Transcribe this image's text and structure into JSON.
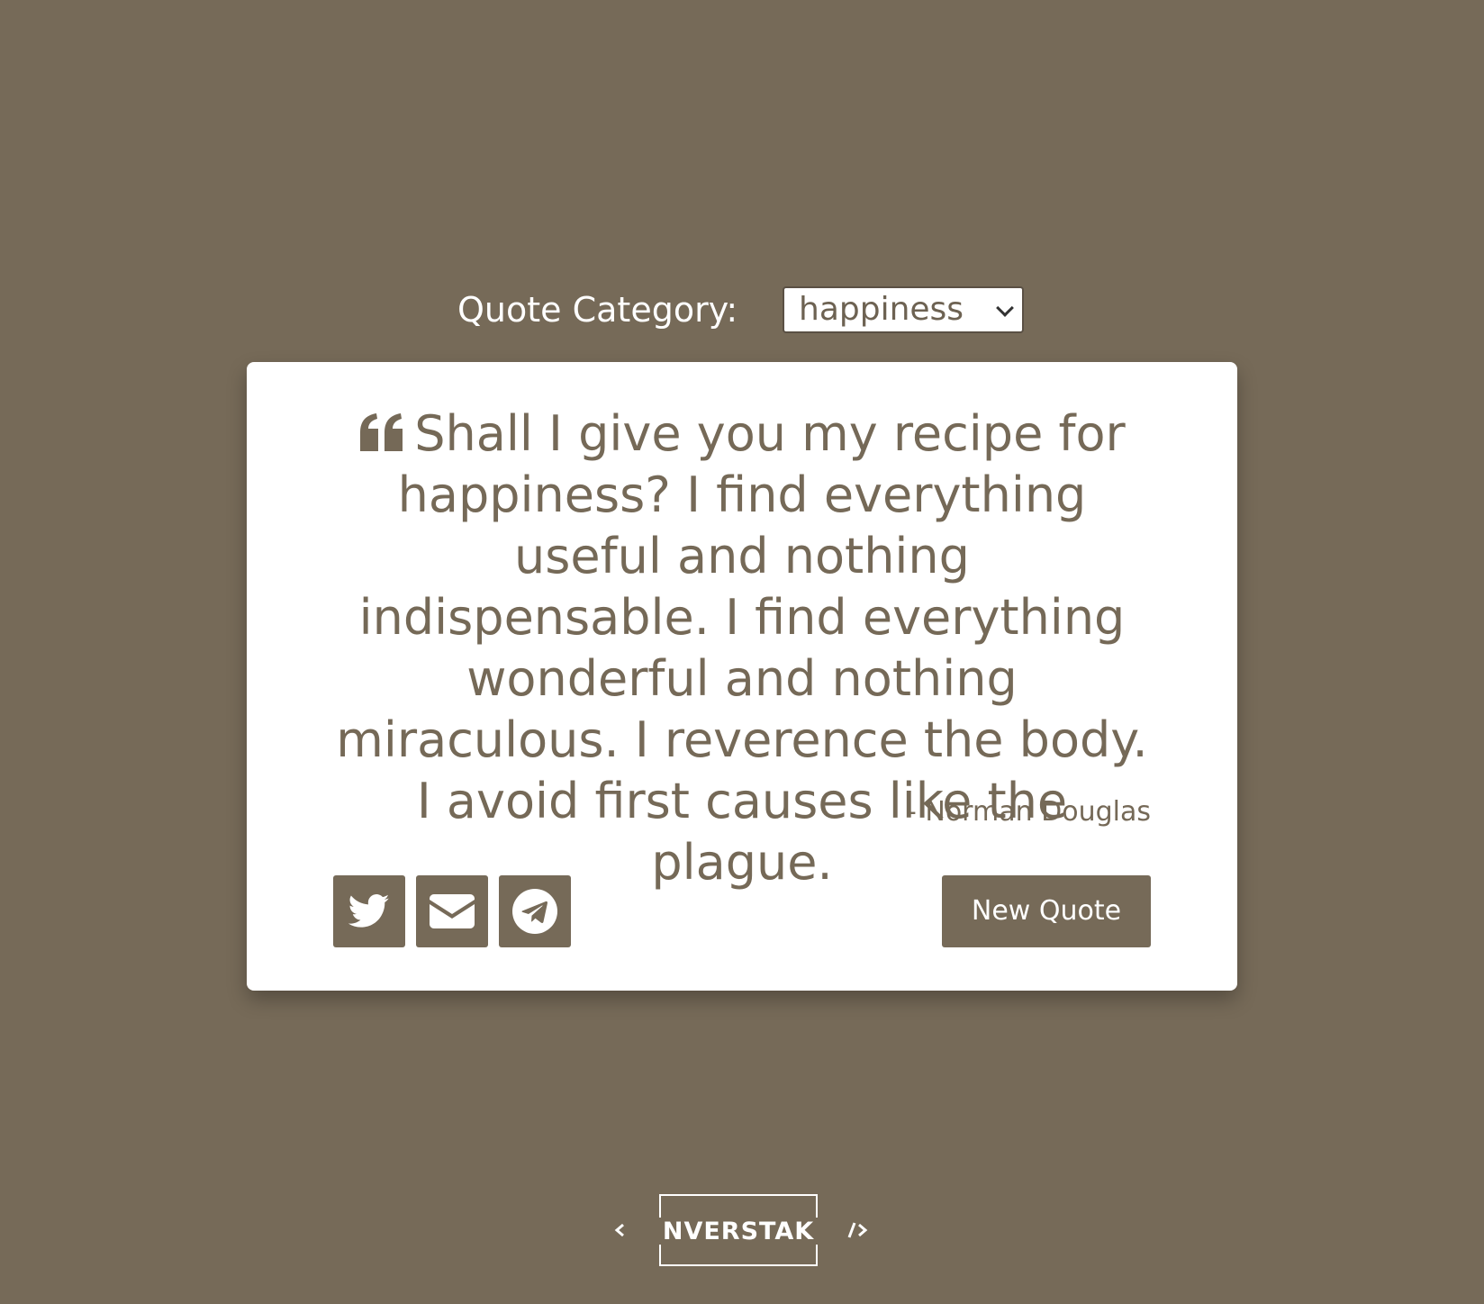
{
  "category": {
    "label": "Quote Category:",
    "selected": "happiness"
  },
  "quote": {
    "text": "Shall I give you my recipe for happiness? I find everything useful and nothing indispensable. I find everything wonderful and nothing miraculous. I reverence the body. I avoid first causes like the plague.",
    "author": "- Norman Douglas"
  },
  "actions": {
    "share_icons": [
      "twitter-icon",
      "envelope-icon",
      "telegram-icon"
    ],
    "new_quote_label": "New Quote"
  },
  "footer": {
    "logo_text": "NVERSTAK"
  },
  "colors": {
    "background": "#766a58",
    "card": "#ffffff",
    "text": "#756957"
  }
}
